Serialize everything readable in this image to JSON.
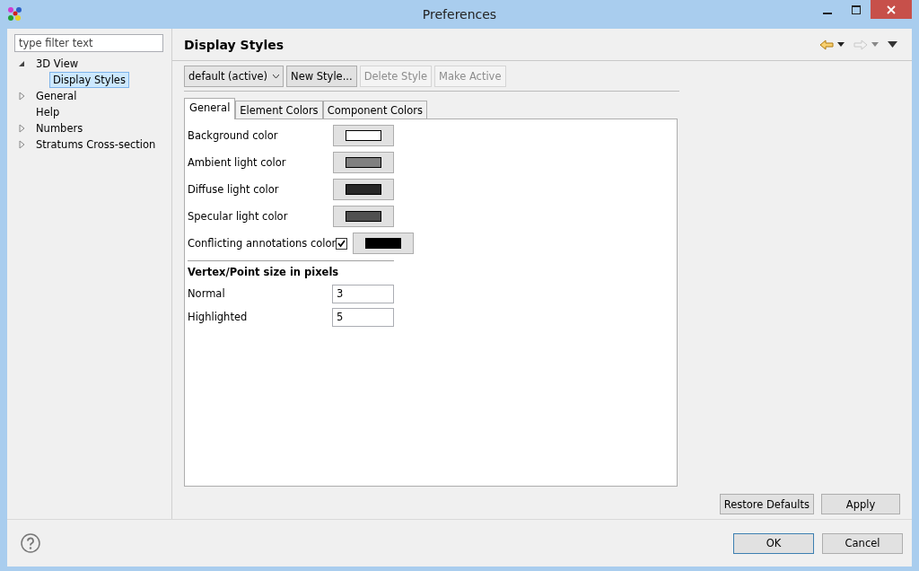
{
  "window": {
    "title": "Preferences"
  },
  "filter": {
    "placeholder": "type filter text"
  },
  "tree": [
    {
      "label": "3D View",
      "expanded": true,
      "selected": false,
      "children": [
        {
          "label": "Display Styles",
          "selected": true
        }
      ]
    },
    {
      "label": "General",
      "expanded": false,
      "selected": false
    },
    {
      "label": "Help",
      "selected": false
    },
    {
      "label": "Numbers",
      "expanded": false,
      "selected": false
    },
    {
      "label": "Stratums Cross-section",
      "expanded": false,
      "selected": false
    }
  ],
  "page": {
    "title": "Display Styles"
  },
  "style_select": {
    "value": "default (active)"
  },
  "style_buttons": [
    {
      "label": "New Style...",
      "disabled": false
    },
    {
      "label": "Delete Style",
      "disabled": true
    },
    {
      "label": "Make Active",
      "disabled": true
    }
  ],
  "tabs": [
    {
      "label": "General",
      "selected": true
    },
    {
      "label": "Element Colors",
      "selected": false
    },
    {
      "label": "Component Colors",
      "selected": false
    }
  ],
  "color_rows": [
    {
      "kind": "color",
      "label": "Background color",
      "color": "#ffffff"
    },
    {
      "kind": "color",
      "label": "Ambient light color",
      "color": "#808080"
    },
    {
      "kind": "color",
      "label": "Diffuse light color",
      "color": "#282828"
    },
    {
      "kind": "color",
      "label": "Specular light color",
      "color": "#505050"
    },
    {
      "kind": "toggle_color",
      "label": "Conflicting annotations color",
      "checked": true,
      "color": "#000000"
    }
  ],
  "size_section": {
    "title": "Vertex/Point size in pixels",
    "fields": [
      {
        "label": "Normal",
        "value": "3"
      },
      {
        "label": "Highlighted",
        "value": "5"
      }
    ]
  },
  "page_buttons": [
    "Restore Defaults",
    "Apply"
  ],
  "dialog_buttons": [
    "OK",
    "Cancel"
  ]
}
